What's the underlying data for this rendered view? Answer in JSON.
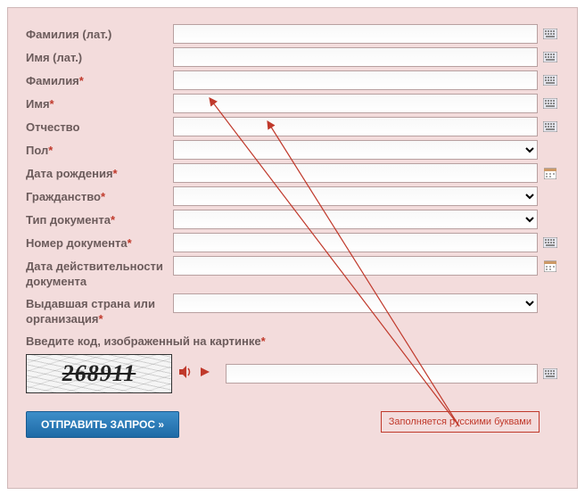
{
  "fields": {
    "surname_lat": {
      "label": "Фамилия (лат.)",
      "required": false,
      "icon": "keyboard"
    },
    "name_lat": {
      "label": "Имя (лат.)",
      "required": false,
      "icon": "keyboard"
    },
    "surname": {
      "label": "Фамилия",
      "required": true,
      "icon": "keyboard"
    },
    "name": {
      "label": "Имя",
      "required": true,
      "icon": "keyboard"
    },
    "patronymic": {
      "label": "Отчество",
      "required": false,
      "icon": "keyboard"
    },
    "gender": {
      "label": "Пол",
      "required": true,
      "icon": "none"
    },
    "dob": {
      "label": "Дата рождения",
      "required": true,
      "icon": "calendar"
    },
    "citizenship": {
      "label": "Гражданство",
      "required": true,
      "icon": "none"
    },
    "doc_type": {
      "label": "Тип документа",
      "required": true,
      "icon": "none"
    },
    "doc_number": {
      "label": "Номер документа",
      "required": true,
      "icon": "keyboard"
    },
    "doc_valid": {
      "label": "Дата действительности документа",
      "required": false,
      "icon": "calendar"
    },
    "issuer": {
      "label": "Выдавшая страна или организация",
      "required": true,
      "icon": "none"
    }
  },
  "captcha": {
    "label": "Введите код, изображенный на картинке",
    "required": true,
    "value": "268911"
  },
  "submit": {
    "label": "ОТПРАВИТЬ ЗАПРОС »"
  },
  "annotation": {
    "text": "Заполняется русскими буквами"
  },
  "required_mark": "*"
}
